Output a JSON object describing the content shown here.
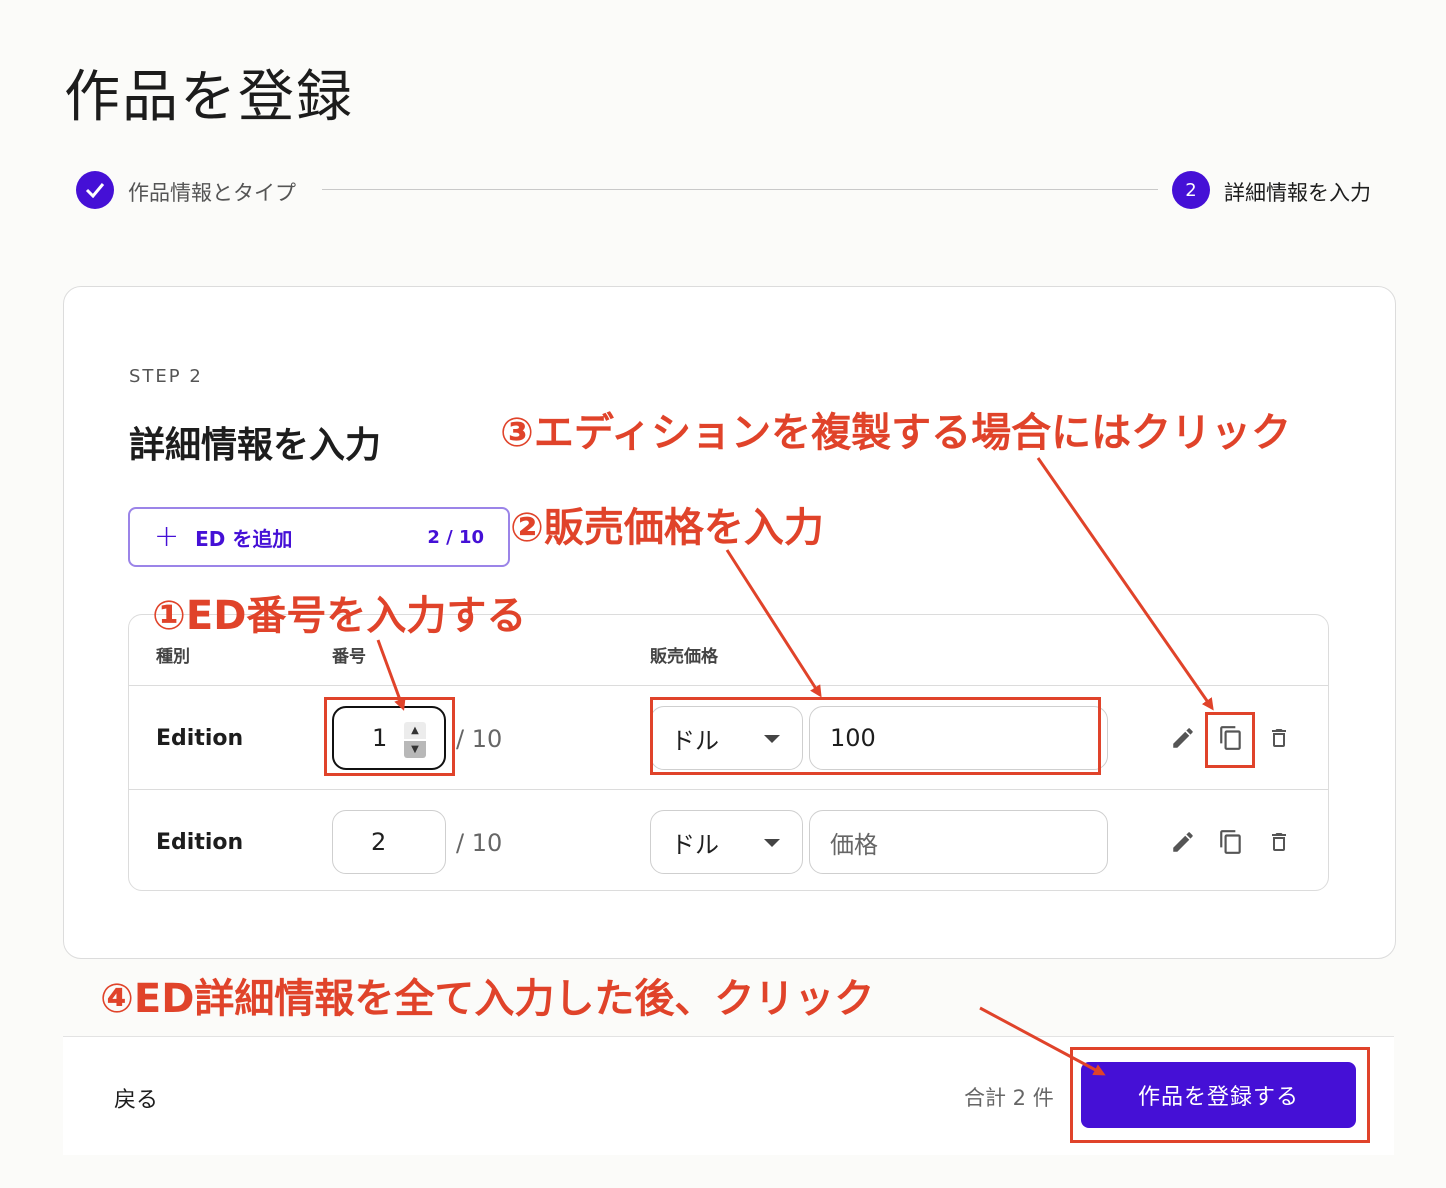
{
  "page": {
    "title": "作品を登録"
  },
  "stepper": {
    "step1": {
      "label": "作品情報とタイプ",
      "icon": "check-icon"
    },
    "step2": {
      "number": "2",
      "label": "詳細情報を入力"
    }
  },
  "card": {
    "step_caption": "STEP 2",
    "title": "詳細情報を入力",
    "add_button": {
      "label": "ED を追加",
      "count": "2 / 10",
      "icon": "plus-icon"
    },
    "table": {
      "headers": {
        "type": "種別",
        "number": "番号",
        "price": "販売価格"
      },
      "rows": [
        {
          "type": "Edition",
          "number": "1",
          "max": "/ 10",
          "currency": "ドル",
          "price": "100",
          "price_placeholder": "価格"
        },
        {
          "type": "Edition",
          "number": "2",
          "max": "/ 10",
          "currency": "ドル",
          "price": "",
          "price_placeholder": "価格"
        }
      ]
    }
  },
  "annotations": {
    "a1": "①ED番号を入力する",
    "a2": "②販売価格を入力",
    "a3": "③エディションを複製する場合にはクリック",
    "a4": "④ED詳細情報を全て入力した後、クリック"
  },
  "footer": {
    "back": "戻る",
    "total": "合計 2 件",
    "submit": "作品を登録する"
  },
  "colors": {
    "accent": "#4510d6",
    "annotation": "#e0432a"
  }
}
